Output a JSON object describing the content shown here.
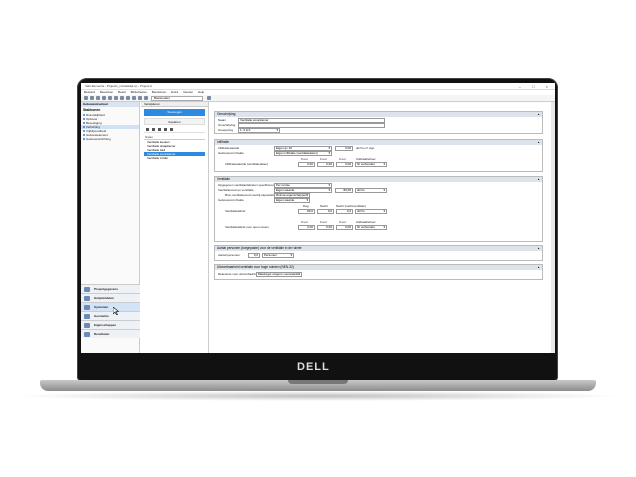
{
  "app": {
    "title": "Vabi Elements - Project1_mindelwijk.vp - Project A",
    "window_controls": [
      "–",
      "□",
      "×"
    ]
  },
  "menu": [
    "Bestand",
    "Bewerken",
    "Beeld",
    "Bibliotheken",
    "Berekenen",
    "Extra",
    "Venster",
    "Help"
  ],
  "toolbar": {
    "search_value": "Basismodel"
  },
  "left_pane": {
    "header": "Gebouwstructuur",
    "tree_title": "Stakhonen",
    "items": [
      "Ruimtelijkheid",
      "Opbouw",
      "Bevestiging",
      "Verlichting",
      "Vrijblijvendheid",
      "Gebouwelement",
      "Gebouwverlichting"
    ]
  },
  "modules": [
    "Projectgegevens",
    "Hulpmiddelen",
    "Systemen",
    "Geometrie",
    "Eigenschappen",
    "Resultaten"
  ],
  "mid_pane": {
    "tab": "Verwijderen",
    "primary_button": "Toevoegen",
    "secondary_button": "Kopiëren",
    "list_header": "Naam",
    "rows": [
      "Ventilatie keuken",
      "Ventilatie slaapkamer",
      "Ventilatie bad",
      "Ventilatie woonkamer",
      "Ventilatie zolder"
    ]
  },
  "form": {
    "sec1": {
      "title": "Omschrijving",
      "naam_label": "Naam",
      "naam_value": "Ventilatie woonkamer",
      "omschr_label": "Omschrijving",
      "groep_label": "Groepering",
      "groep_value": "1. 0 & 0"
    },
    "sec2": {
      "title": "Infiltratie",
      "r1_label": "Infiltratiewaarde",
      "r1_value": "Eigen qv 10",
      "r1_num": "0,00",
      "r1_unit": "dm³/s·m² vlgo",
      "r2_label": "Gebouwvorm/zakte",
      "r2_value": "Eigen infiltratie (ventilatiedelen)",
      "r3_label": "Infiltratiewaarde (ventilatiedelen)",
      "cols": [
        "0 uur",
        "0 uur",
        "0 uur",
        "Uitdraaibeheer"
      ],
      "r3_vals": [
        "0,00",
        "0,00",
        "0,00",
        "Nt verbonden"
      ]
    },
    "sec3": {
      "title": "Ventilatie",
      "r1_label": "Opgegeven ventilatiedebieten specificeren",
      "r1_value": "Per ruimte",
      "r2_label": "Ventilatievoud en ventilatie",
      "r2_value": "Eigen waarde",
      "r2_num": "80,00",
      "r2_unit": "dm³/s",
      "r3_label": "Bron ventilatievoud voorbij-capaciteit",
      "r3_value": "Ruimte-eigenschappen",
      "r4_label": "Gebouwvorm/zakte",
      "r4_value": "Eigen waarde",
      "r5_label": "Ventilatiedebiet",
      "cols5": [
        "Dag",
        "Nacht",
        "Nacht (nachtventilatie)"
      ],
      "r5_vals": [
        "80,0",
        "0,0",
        "0,0",
        "dm³/s"
      ],
      "r6_label": "Ventilatiedebiet over open ramen",
      "cols6": [
        "0 uur",
        "0 uur",
        "0 uur",
        "Uitdraaibeheer"
      ],
      "r6_vals": [
        "0,00",
        "0,00",
        "0,00",
        "Nt verbonden"
      ]
    },
    "sec4": {
      "title": "Aantal personen (toegepaste) voor de ventilatie in de ruimte",
      "label": "Aantal personen",
      "num": "0,0",
      "value": "Personen"
    },
    "sec5": {
      "title": "Uitvoerbaarheid ventilatie voor hoge ruimten (NEN-32)",
      "label": "Relevante voor uitvoerbaarheid",
      "value": "Maatregel volgens voorwaarde"
    }
  },
  "brand": "DELL"
}
